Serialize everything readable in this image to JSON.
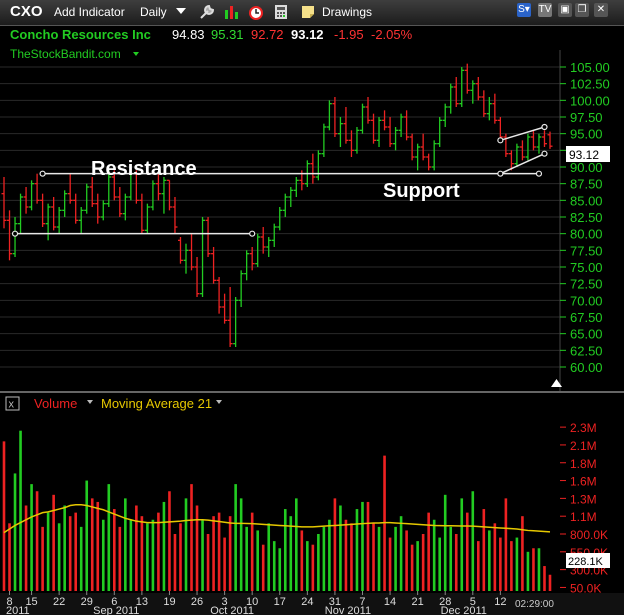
{
  "toolbar": {
    "symbol": "CXO",
    "add_indicator": "Add Indicator",
    "interval": "Daily",
    "drawings": "Drawings",
    "icons": [
      "wrench-icon",
      "bar-chart-icon",
      "alarm-clock-icon",
      "calculator-icon",
      "note-icon"
    ],
    "window_icons": [
      "s-badge-icon",
      "tv-badge-icon",
      "restore-icon",
      "close-icon"
    ]
  },
  "quote": {
    "name": "Concho Resources Inc",
    "open": "94.83",
    "high": "95.31",
    "low": "92.72",
    "last": "93.12",
    "change": "-1.95",
    "pct": "-2.05%",
    "colors": {
      "name": "#22cc22",
      "open": "#ffffff",
      "high": "#33dd33",
      "low": "#ff3333",
      "last": "#ffffff",
      "change": "#ff3333",
      "pct": "#ff3333"
    }
  },
  "watermark": "TheStockBandit.com",
  "annotations": {
    "resistance": "Resistance",
    "support": "Support",
    "price_tag": "93.12"
  },
  "volume_panel": {
    "volume_label": "Volume",
    "ma_label": "Moving Average 21",
    "last_volume": "228.1K",
    "clock": "02:29:00"
  },
  "colors": {
    "up": "#22cc22",
    "down": "#ee2222",
    "ma": "#e6c800",
    "axis": "#22cc22",
    "grid": "#2a2a2a",
    "line": "#e8e8e8"
  },
  "chart_data": [
    {
      "type": "candlestick",
      "title": "Concho Resources Inc",
      "xlabel": "",
      "ylabel": "",
      "ylim": [
        58.5,
        106.5
      ],
      "y_ticks": [
        "105.00",
        "102.50",
        "100.00",
        "97.50",
        "95.00",
        "92.50",
        "90.00",
        "87.50",
        "85.00",
        "82.50",
        "80.00",
        "77.50",
        "75.00",
        "72.50",
        "70.00",
        "67.50",
        "65.00",
        "62.50",
        "60.00"
      ],
      "x_ticks": [
        {
          "index": 1,
          "label": "8"
        },
        {
          "index": 5,
          "label": "15"
        },
        {
          "index": 10,
          "label": "22"
        },
        {
          "index": 15,
          "label": "29"
        },
        {
          "index": 20,
          "label": "6"
        },
        {
          "index": 25,
          "label": "13"
        },
        {
          "index": 30,
          "label": "19"
        },
        {
          "index": 35,
          "label": "26"
        },
        {
          "index": 40,
          "label": "3"
        },
        {
          "index": 45,
          "label": "10"
        },
        {
          "index": 50,
          "label": "17"
        },
        {
          "index": 55,
          "label": "24"
        },
        {
          "index": 60,
          "label": "31"
        },
        {
          "index": 65,
          "label": "7"
        },
        {
          "index": 70,
          "label": "14"
        },
        {
          "index": 75,
          "label": "21"
        },
        {
          "index": 80,
          "label": "28"
        },
        {
          "index": 85,
          "label": "5"
        },
        {
          "index": 90,
          "label": "12"
        }
      ],
      "period_labels": [
        {
          "index": 0,
          "label": "2011"
        },
        {
          "index": 20,
          "label": "Sep 2011"
        },
        {
          "index": 41,
          "label": "Oct 2011"
        },
        {
          "index": 62,
          "label": "Nov 2011"
        },
        {
          "index": 83,
          "label": "Dec 2011"
        }
      ],
      "ohlc": [
        [
          86.0,
          88.5,
          80.8,
          82.0
        ],
        [
          82.0,
          83.5,
          76.0,
          77.0
        ],
        [
          77.0,
          82.5,
          76.5,
          81.5
        ],
        [
          81.5,
          86.0,
          80.0,
          85.5
        ],
        [
          85.5,
          87.0,
          83.0,
          84.0
        ],
        [
          84.0,
          88.0,
          83.5,
          87.5
        ],
        [
          87.5,
          89.0,
          84.5,
          85.0
        ],
        [
          85.0,
          86.0,
          81.0,
          81.5
        ],
        [
          81.5,
          84.5,
          79.0,
          84.0
        ],
        [
          84.0,
          85.5,
          80.5,
          81.0
        ],
        [
          81.0,
          84.0,
          80.0,
          83.5
        ],
        [
          83.5,
          86.5,
          82.5,
          86.0
        ],
        [
          86.0,
          89.0,
          84.5,
          85.0
        ],
        [
          85.0,
          86.0,
          81.5,
          82.0
        ],
        [
          82.0,
          84.0,
          80.0,
          83.5
        ],
        [
          83.5,
          87.5,
          83.0,
          87.0
        ],
        [
          87.0,
          88.5,
          84.0,
          84.5
        ],
        [
          84.5,
          86.0,
          81.5,
          82.5
        ],
        [
          82.5,
          85.0,
          82.0,
          84.5
        ],
        [
          84.5,
          89.5,
          84.0,
          88.5
        ],
        [
          88.5,
          89.5,
          85.0,
          85.5
        ],
        [
          85.5,
          87.0,
          82.5,
          83.0
        ],
        [
          83.0,
          86.0,
          82.0,
          85.5
        ],
        [
          85.5,
          89.5,
          85.0,
          89.0
        ],
        [
          89.0,
          89.5,
          84.5,
          85.0
        ],
        [
          85.0,
          86.0,
          80.0,
          80.5
        ],
        [
          80.5,
          84.5,
          80.0,
          84.0
        ],
        [
          84.0,
          88.0,
          83.5,
          87.5
        ],
        [
          87.5,
          89.0,
          85.0,
          86.0
        ],
        [
          86.0,
          88.5,
          83.0,
          88.0
        ],
        [
          88.0,
          88.0,
          83.5,
          84.0
        ],
        [
          84.0,
          85.5,
          80.0,
          81.0
        ],
        [
          79.0,
          79.5,
          75.5,
          76.0
        ],
        [
          76.0,
          78.5,
          74.0,
          77.5
        ],
        [
          77.5,
          80.0,
          74.5,
          75.0
        ],
        [
          75.0,
          76.5,
          70.5,
          71.0
        ],
        [
          71.0,
          82.5,
          70.5,
          82.0
        ],
        [
          82.0,
          82.5,
          76.5,
          77.0
        ],
        [
          77.0,
          78.0,
          72.5,
          73.0
        ],
        [
          73.0,
          73.5,
          68.0,
          69.0
        ],
        [
          69.0,
          71.0,
          66.5,
          67.0
        ],
        [
          67.0,
          72.0,
          63.0,
          63.5
        ],
        [
          63.5,
          70.5,
          63.0,
          70.0
        ],
        [
          70.0,
          74.5,
          69.0,
          74.0
        ],
        [
          74.0,
          77.5,
          73.0,
          77.0
        ],
        [
          77.0,
          78.0,
          74.5,
          75.5
        ],
        [
          75.5,
          80.0,
          75.0,
          79.5
        ],
        [
          79.5,
          81.0,
          77.0,
          78.0
        ],
        [
          78.0,
          79.5,
          76.5,
          79.0
        ],
        [
          79.0,
          81.5,
          78.0,
          81.0
        ],
        [
          81.0,
          84.0,
          80.5,
          83.5
        ],
        [
          83.5,
          86.0,
          82.5,
          85.5
        ],
        [
          85.5,
          87.0,
          84.0,
          86.5
        ],
        [
          86.5,
          88.5,
          85.5,
          88.0
        ],
        [
          88.0,
          89.5,
          86.5,
          87.5
        ],
        [
          87.5,
          91.0,
          87.0,
          90.5
        ],
        [
          90.5,
          92.0,
          87.5,
          88.5
        ],
        [
          88.5,
          92.5,
          88.0,
          92.0
        ],
        [
          92.0,
          96.5,
          91.5,
          96.0
        ],
        [
          96.0,
          100.0,
          95.5,
          99.5
        ],
        [
          99.5,
          100.5,
          94.5,
          95.0
        ],
        [
          95.0,
          97.5,
          93.0,
          96.5
        ],
        [
          96.5,
          99.0,
          93.5,
          94.0
        ],
        [
          94.0,
          95.5,
          91.5,
          92.5
        ],
        [
          92.5,
          96.0,
          92.0,
          95.5
        ],
        [
          95.5,
          99.5,
          95.0,
          99.0
        ],
        [
          99.0,
          100.5,
          96.5,
          97.0
        ],
        [
          97.0,
          98.0,
          93.5,
          94.0
        ],
        [
          94.0,
          97.5,
          93.0,
          97.0
        ],
        [
          97.0,
          98.5,
          95.5,
          96.0
        ],
        [
          96.0,
          97.5,
          93.0,
          93.5
        ],
        [
          93.5,
          96.0,
          92.5,
          95.5
        ],
        [
          95.5,
          98.0,
          94.5,
          97.5
        ],
        [
          97.5,
          98.5,
          94.0,
          94.5
        ],
        [
          94.5,
          95.0,
          91.0,
          91.5
        ],
        [
          91.5,
          93.5,
          89.5,
          93.0
        ],
        [
          93.0,
          95.0,
          91.0,
          91.5
        ],
        [
          91.5,
          92.0,
          89.5,
          90.0
        ],
        [
          90.0,
          94.0,
          89.5,
          93.5
        ],
        [
          93.5,
          97.5,
          93.0,
          97.0
        ],
        [
          97.0,
          99.5,
          96.0,
          99.0
        ],
        [
          99.0,
          102.5,
          98.0,
          102.0
        ],
        [
          102.0,
          103.5,
          99.0,
          99.5
        ],
        [
          99.5,
          105.0,
          99.0,
          104.5
        ],
        [
          104.5,
          105.5,
          101.0,
          101.5
        ],
        [
          101.5,
          103.0,
          99.5,
          102.5
        ],
        [
          102.5,
          103.5,
          100.0,
          100.5
        ],
        [
          100.5,
          101.5,
          97.5,
          98.0
        ],
        [
          98.0,
          100.5,
          97.0,
          99.5
        ],
        [
          99.5,
          101.0,
          96.5,
          97.0
        ],
        [
          97.0,
          97.5,
          94.0,
          94.5
        ],
        [
          94.5,
          95.0,
          91.5,
          92.0
        ],
        [
          92.0,
          92.5,
          89.5,
          90.5
        ],
        [
          90.5,
          93.5,
          90.0,
          93.0
        ],
        [
          93.0,
          94.0,
          91.0,
          91.5
        ],
        [
          91.5,
          95.0,
          91.0,
          94.5
        ],
        [
          94.5,
          95.5,
          92.5,
          93.0
        ],
        [
          93.0,
          95.0,
          92.0,
          94.5
        ],
        [
          94.5,
          95.5,
          93.0,
          93.5
        ],
        [
          94.83,
          95.31,
          92.72,
          93.12
        ]
      ],
      "trendlines": [
        {
          "name": "Resistance",
          "points": [
            [
              7,
              89.0
            ],
            [
              97,
              89.0
            ]
          ]
        },
        {
          "name": "Support",
          "points": [
            [
              2,
              80.0
            ],
            [
              45,
              80.0
            ]
          ]
        },
        {
          "name": "upper-channel",
          "points": [
            [
              90,
              94.0
            ],
            [
              98,
              96.0
            ]
          ]
        },
        {
          "name": "lower-channel",
          "points": [
            [
              90,
              89.0
            ],
            [
              98,
              92.0
            ]
          ]
        }
      ]
    },
    {
      "type": "bar",
      "title": "Volume",
      "series_names": [
        "Volume",
        "Moving Average 21"
      ],
      "y_ticks": [
        "2.3M",
        "2.1M",
        "1.8M",
        "1.6M",
        "1.3M",
        "1.1M",
        "800.0K",
        "550.0K",
        "300.0K",
        "50.0K"
      ],
      "ylim": [
        0,
        2400000
      ],
      "volume": [
        2100000,
        950000,
        1650000,
        2250000,
        1200000,
        1500000,
        1400000,
        900000,
        1100000,
        1350000,
        950000,
        1200000,
        1050000,
        1100000,
        900000,
        1550000,
        1300000,
        1250000,
        1000000,
        1500000,
        1150000,
        900000,
        1300000,
        1000000,
        1200000,
        1050000,
        950000,
        1000000,
        1100000,
        1250000,
        1400000,
        800000,
        950000,
        1300000,
        1500000,
        1200000,
        1000000,
        800000,
        1050000,
        1100000,
        750000,
        1050000,
        1500000,
        1300000,
        900000,
        1100000,
        850000,
        650000,
        950000,
        700000,
        600000,
        1150000,
        1050000,
        1300000,
        850000,
        700000,
        650000,
        800000,
        900000,
        1000000,
        1300000,
        1200000,
        1000000,
        950000,
        1150000,
        1250000,
        1250000,
        950000,
        900000,
        1900000,
        750000,
        900000,
        1050000,
        850000,
        650000,
        700000,
        800000,
        1100000,
        1000000,
        750000,
        1350000,
        900000,
        800000,
        1300000,
        1100000,
        1400000,
        700000,
        1150000,
        850000,
        950000,
        750000,
        1300000,
        700000,
        750000,
        1050000,
        550000,
        600000,
        600000,
        350000,
        228100
      ],
      "moving_average_21": [
        820000,
        870000,
        920000,
        960000,
        1000000,
        1040000,
        1070000,
        1100000,
        1110000,
        1130000,
        1150000,
        1170000,
        1200000,
        1210000,
        1210000,
        1200000,
        1180000,
        1160000,
        1140000,
        1110000,
        1080000,
        1050000,
        1020000,
        1000000,
        980000,
        970000,
        960000,
        960000,
        960000,
        965000,
        970000,
        975000,
        980000,
        990000,
        995000,
        1000000,
        1000000,
        995000,
        985000,
        975000,
        965000,
        955000,
        950000,
        950000,
        948000,
        945000,
        940000,
        935000,
        930000,
        925000,
        920000,
        915000,
        910000,
        905000,
        900000,
        900000,
        900000,
        905000,
        910000,
        915000,
        920000,
        925000,
        930000,
        935000,
        940000,
        945000,
        950000,
        955000,
        955000,
        960000,
        960000,
        955000,
        950000,
        945000,
        940000,
        935000,
        930000,
        925000,
        920000,
        918000,
        916000,
        915000,
        914000,
        913000,
        912000,
        910000,
        905000,
        900000,
        895000,
        890000,
        885000,
        880000,
        875000,
        870000,
        860000,
        850000,
        845000,
        840000,
        835000,
        830000
      ]
    }
  ]
}
